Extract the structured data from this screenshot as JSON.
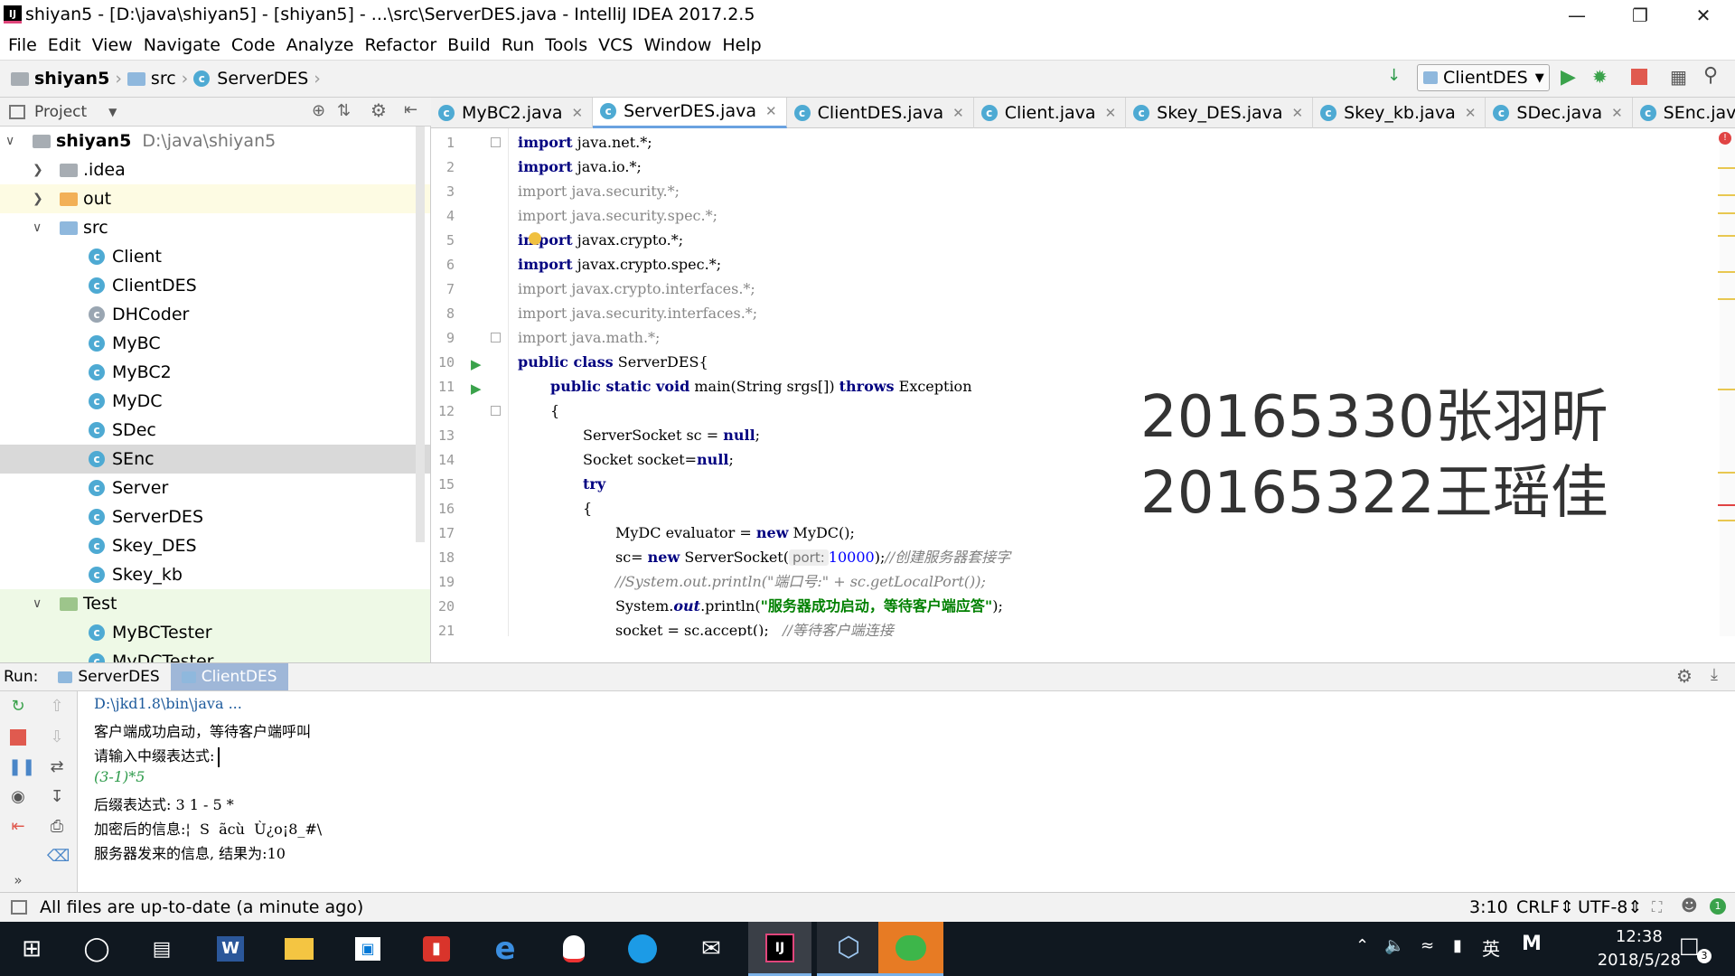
{
  "window": {
    "title": "shiyan5 - [D:\\java\\shiyan5] - [shiyan5] - ...\\src\\ServerDES.java - IntelliJ IDEA 2017.2.5",
    "app_icon": "IJ"
  },
  "menu": [
    "File",
    "Edit",
    "View",
    "Navigate",
    "Code",
    "Analyze",
    "Refactor",
    "Build",
    "Run",
    "Tools",
    "VCS",
    "Window",
    "Help"
  ],
  "breadcrumb": {
    "project": "shiyan5",
    "folder": "src",
    "file": "ServerDES"
  },
  "toolbar": {
    "run_config": "ClientDES"
  },
  "project_panel": {
    "title": "Project",
    "root": {
      "name": "shiyan5",
      "path": "D:\\java\\shiyan5"
    },
    "items": [
      {
        "label": ".idea",
        "type": "folder"
      },
      {
        "label": "out",
        "type": "folder"
      },
      {
        "label": "src",
        "type": "folder"
      },
      {
        "label": "Client",
        "type": "class"
      },
      {
        "label": "ClientDES",
        "type": "class"
      },
      {
        "label": "DHCoder",
        "type": "class"
      },
      {
        "label": "MyBC",
        "type": "class"
      },
      {
        "label": "MyBC2",
        "type": "class"
      },
      {
        "label": "MyDC",
        "type": "class"
      },
      {
        "label": "SDec",
        "type": "class"
      },
      {
        "label": "SEnc",
        "type": "class"
      },
      {
        "label": "Server",
        "type": "class"
      },
      {
        "label": "ServerDES",
        "type": "class"
      },
      {
        "label": "Skey_DES",
        "type": "class"
      },
      {
        "label": "Skey_kb",
        "type": "class"
      },
      {
        "label": "Test",
        "type": "folder"
      },
      {
        "label": "MyBCTester",
        "type": "class"
      },
      {
        "label": "MyDCTester",
        "type": "class"
      }
    ]
  },
  "tabs": [
    "MyBC2.java",
    "ServerDES.java",
    "ClientDES.java",
    "Client.java",
    "Skey_DES.java",
    "Skey_kb.java",
    "SDec.java",
    "SEnc.java"
  ],
  "active_tab": "ServerDES.java",
  "code_lines": [
    "1",
    "2",
    "3",
    "4",
    "5",
    "6",
    "7",
    "8",
    "9",
    "10",
    "11",
    "12",
    "13",
    "14",
    "15",
    "16",
    "17",
    "18",
    "19",
    "20",
    "21"
  ],
  "code": {
    "l1a": "import",
    "l1b": " java.net.*;",
    "l2a": "import",
    "l2b": " java.io.*;",
    "l3": "import java.security.*;",
    "l4": "import java.security.spec.*;",
    "l5a": "import",
    "l5b": " javax.crypto.*;",
    "l6a": "import",
    "l6b": " javax.crypto.spec.*;",
    "l7": "import javax.crypto.interfaces.*;",
    "l8": "import java.security.interfaces.*;",
    "l9": "import java.math.*;",
    "l10a": "public class",
    "l10b": " ServerDES{",
    "l11a": "public static void",
    "l11b": " main(String srgs[]) ",
    "l11c": "throws",
    "l11d": " Exception",
    "l12": "{",
    "l13a": "ServerSocket sc = ",
    "l13b": "null",
    ";": ";",
    "l14a": "Socket socket=",
    "l14b": "null",
    "l15": "try",
    "l16": "{",
    "l17a": "MyDC evaluator = ",
    "l17b": "new",
    "l17c": " MyDC();",
    "l18a": "sc= ",
    "l18b": "new",
    "l18c": " ServerSocket(",
    "l18hint": "port:",
    "l18num": "10000",
    "l18d": ");",
    "l18cm": "//创建服务器套接字",
    "l19": "//System.out.println(\"端口号:\" + sc.getLocalPort());",
    "l20a": "System.",
    "l20b": "out",
    "l20c": ".println(",
    "l20str": "\"服务器成功启动，等待客户端应答\"",
    "l20d": ");",
    "l21a": "socket = sc.accept();",
    "l21cm": "//等待客户端连接"
  },
  "watermark": [
    "20165330张羽昕",
    "20165322王瑶佳"
  ],
  "run": {
    "label": "Run:",
    "tabs": [
      "ServerDES",
      "ClientDES"
    ],
    "active": "ClientDES"
  },
  "console": [
    "D:\\jkd1.8\\bin\\java ...",
    "客户端成功启动，等待客户端呼叫",
    "请输入中缀表达式:",
    "(3-1)*5",
    "后缀表达式: 3 1 - 5 *",
    "加密后的信息:¦  S  ãcù  Ù¿o¡8_#\\",
    "服务器发来的信息, 结果为:10"
  ],
  "status": {
    "message": "All files are up-to-date (a minute ago)",
    "position": "3:10",
    "line_sep": "CRLF",
    "encoding": "UTF-8"
  },
  "taskbar": {
    "time": "12:38",
    "date": "2018/5/28",
    "ime": "英",
    "notifications": "3"
  }
}
